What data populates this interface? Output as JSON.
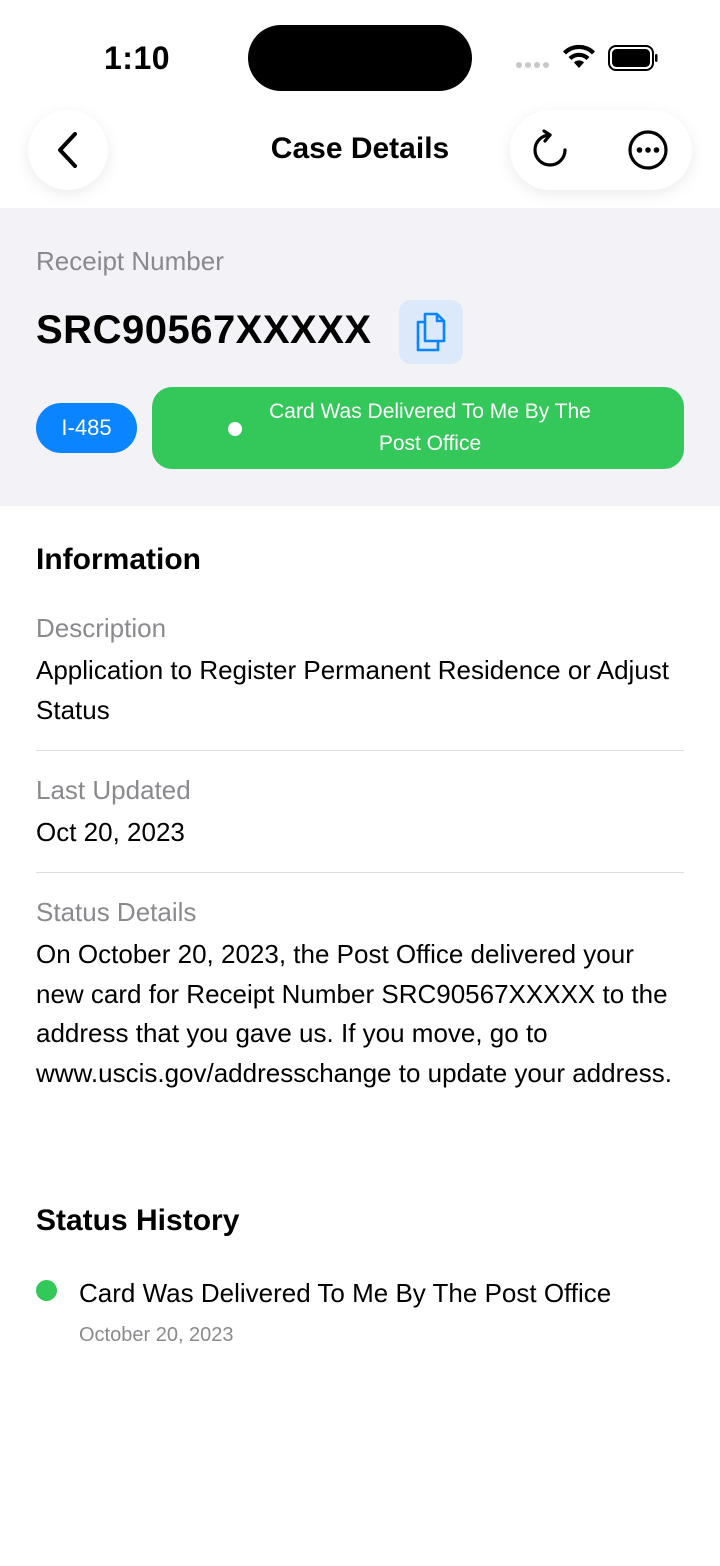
{
  "status_bar": {
    "time": "1:10"
  },
  "nav": {
    "title": "Case Details",
    "back_icon": "chevron-left-icon",
    "refresh_icon": "refresh-icon",
    "more_icon": "ellipsis-circle-icon"
  },
  "receipt": {
    "label": "Receipt Number",
    "number": "SRC90567XXXXX",
    "copy_icon": "copy-icon",
    "form_type": "I-485",
    "status": "Card Was Delivered To Me By The Post Office"
  },
  "information": {
    "heading": "Information",
    "description_label": "Description",
    "description_value": "Application to Register Permanent Residence or Adjust Status",
    "last_updated_label": "Last Updated",
    "last_updated_value": "Oct 20, 2023",
    "status_details_label": "Status Details",
    "status_details_value": "On October 20, 2023, the Post Office delivered your new card for Receipt Number SRC90567XXXXX to the address that you gave us. If you move, go to www.uscis.gov/addresschange to update your address."
  },
  "status_history": {
    "heading": "Status History",
    "items": [
      {
        "title": "Card Was Delivered To Me By The Post Office",
        "date": "October 20, 2023"
      }
    ]
  },
  "colors": {
    "accent_blue": "#0a84ff",
    "success_green": "#34c759",
    "secondary_text": "#8a8a8e",
    "header_bg": "#f2f2f7"
  }
}
